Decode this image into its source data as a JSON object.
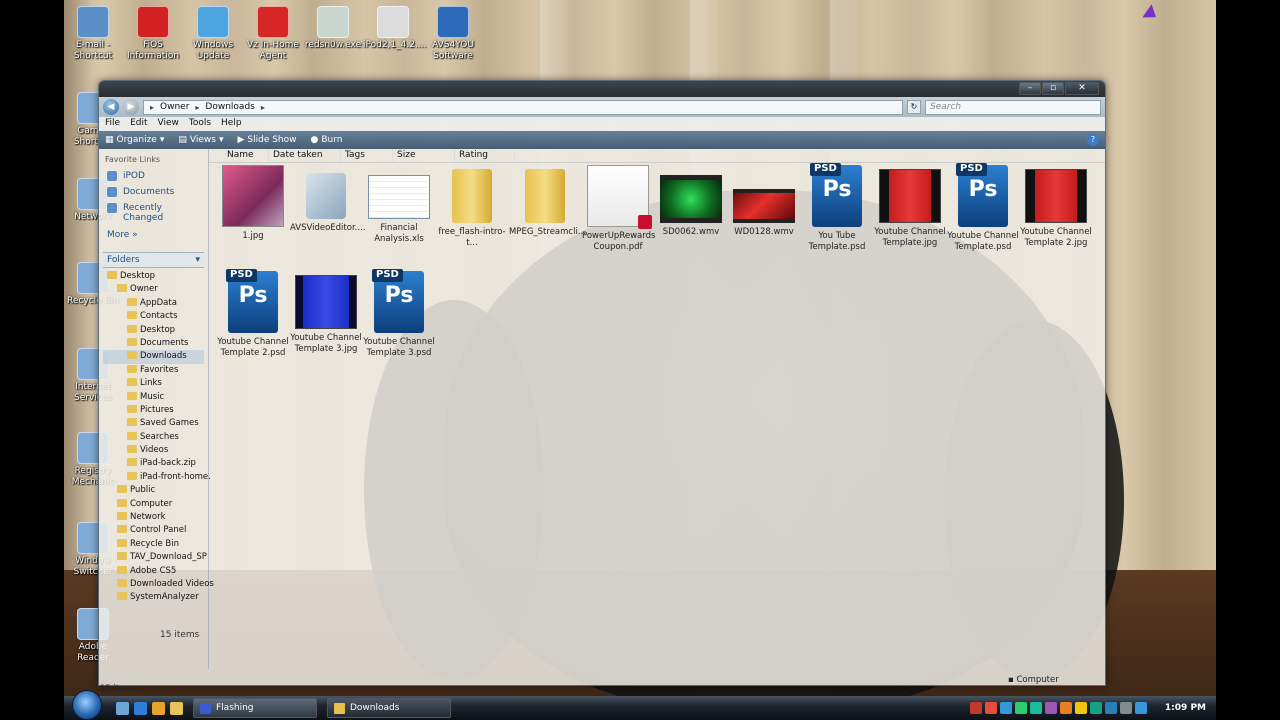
{
  "desktop_icons": [
    {
      "label": "E-mail - Shortcut",
      "color": "#5b8fc8"
    },
    {
      "label": "FiOS Information",
      "color": "#d32020"
    },
    {
      "label": "Windows Update",
      "color": "#4da5e0"
    },
    {
      "label": "Vz In-Home Agent",
      "color": "#d62626"
    },
    {
      "label": "redsn0w.exe",
      "color": "#c9d6cf"
    },
    {
      "label": "iPod2,1_4.2....",
      "color": "#dcdcdc"
    },
    {
      "label": "AVS4YOU Software",
      "color": "#2a6ab8"
    }
  ],
  "left_desktop_icons": [
    {
      "label": "Games Shortcut"
    },
    {
      "label": "Network"
    },
    {
      "label": "Recycle Bin"
    },
    {
      "label": "Internet Services"
    },
    {
      "label": "Registry Mechanic"
    },
    {
      "label": "Window Switcher"
    },
    {
      "label": "Adobe Reader"
    }
  ],
  "window": {
    "breadcrumb": [
      "Owner",
      "Downloads"
    ],
    "search_placeholder": "Search",
    "controls": {
      "minimize": "–",
      "maximize": "▫",
      "close": "✕"
    },
    "menu": [
      "File",
      "Edit",
      "View",
      "Tools",
      "Help"
    ],
    "toolbar": [
      {
        "label": "Organize",
        "icon": "organize-icon"
      },
      {
        "label": "Views",
        "icon": "views-icon"
      },
      {
        "label": "Slide Show",
        "icon": "slideshow-icon"
      },
      {
        "label": "Burn",
        "icon": "burn-icon"
      }
    ],
    "favorite_links_heading": "Favorite Links",
    "favorite_links": [
      "iPOD",
      "Documents",
      "Recently Changed"
    ],
    "more_label": "More",
    "folders_label": "Folders",
    "tree": [
      {
        "label": "Desktop",
        "indent": 0
      },
      {
        "label": "Owner",
        "indent": 1
      },
      {
        "label": "AppData",
        "indent": 2
      },
      {
        "label": "Contacts",
        "indent": 2
      },
      {
        "label": "Desktop",
        "indent": 2
      },
      {
        "label": "Documents",
        "indent": 2
      },
      {
        "label": "Downloads",
        "indent": 2,
        "selected": true
      },
      {
        "label": "Favorites",
        "indent": 2
      },
      {
        "label": "Links",
        "indent": 2
      },
      {
        "label": "Music",
        "indent": 2
      },
      {
        "label": "Pictures",
        "indent": 2
      },
      {
        "label": "Saved Games",
        "indent": 2
      },
      {
        "label": "Searches",
        "indent": 2
      },
      {
        "label": "Videos",
        "indent": 2
      },
      {
        "label": "iPad-back.zip",
        "indent": 2
      },
      {
        "label": "iPad-front-home.",
        "indent": 2
      },
      {
        "label": "Public",
        "indent": 1
      },
      {
        "label": "Computer",
        "indent": 1
      },
      {
        "label": "Network",
        "indent": 1
      },
      {
        "label": "Control Panel",
        "indent": 1
      },
      {
        "label": "Recycle Bin",
        "indent": 1
      },
      {
        "label": "TAV_Download_SP",
        "indent": 1
      },
      {
        "label": "Adobe CS5",
        "indent": 1
      },
      {
        "label": "Downloaded Videos",
        "indent": 1
      },
      {
        "label": "SystemAnalyzer",
        "indent": 1
      }
    ],
    "columns": [
      "Name",
      "Date taken",
      "Tags",
      "Size",
      "Rating"
    ],
    "files": [
      {
        "name": "1.jpg",
        "kind": "jpg-pink"
      },
      {
        "name": "AVSVideoEditor....",
        "kind": "exe"
      },
      {
        "name": "Financial Analysis.xls",
        "kind": "xls"
      },
      {
        "name": "free_flash-intro-t...",
        "kind": "zip"
      },
      {
        "name": "MPEG_Streamcli...",
        "kind": "zip"
      },
      {
        "name": "PowerUpRewards Coupon.pdf",
        "kind": "pdf"
      },
      {
        "name": "SD0062.wmv",
        "kind": "vid-green"
      },
      {
        "name": "WD0128.wmv",
        "kind": "vid-red"
      },
      {
        "name": "You Tube Template.psd",
        "kind": "psd"
      },
      {
        "name": "Youtube Channel Template.jpg",
        "kind": "tpl-red"
      },
      {
        "name": "Youtube Channel Template.psd",
        "kind": "psd"
      },
      {
        "name": "Youtube Channel Template 2.jpg",
        "kind": "tpl-red"
      },
      {
        "name": "Youtube Channel Template 2.psd",
        "kind": "psd"
      },
      {
        "name": "Youtube Channel Template 3.jpg",
        "kind": "tpl-blue"
      },
      {
        "name": "Youtube Channel Template 3.psd",
        "kind": "psd"
      }
    ],
    "psd_badge": "PSD",
    "psd_mark": "Ps",
    "status_items": "15 items",
    "status_items_outer": "15 items",
    "status_computer": "Computer"
  },
  "taskbar": {
    "tasks": [
      {
        "label": "Flashing",
        "active": true
      },
      {
        "label": "Downloads",
        "active": false
      }
    ],
    "clock": "1:09 PM",
    "tray_colors": [
      "#c0392b",
      "#e74c3c",
      "#3498db",
      "#2ecc71",
      "#1abc9c",
      "#9b59b6",
      "#e67e22",
      "#f1c40f",
      "#16a085",
      "#2980b9",
      "#7f8c8d",
      "#3498db"
    ]
  }
}
